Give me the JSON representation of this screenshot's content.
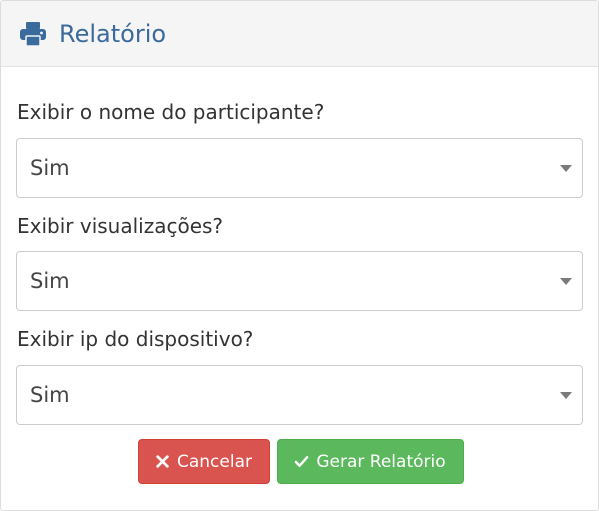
{
  "panel": {
    "title": "Relatório",
    "icon": "printer-icon"
  },
  "fields": [
    {
      "label": "Exibir o nome do participante?",
      "value": "Sim"
    },
    {
      "label": "Exibir visualizações?",
      "value": "Sim"
    },
    {
      "label": "Exibir ip do dispositivo?",
      "value": "Sim"
    }
  ],
  "buttons": {
    "cancel_label": "Cancelar",
    "cancel_icon": "times-icon",
    "generate_label": "Gerar Relatório",
    "generate_icon": "check-icon"
  },
  "colors": {
    "title": "#3b6a9c",
    "cancel": "#d9534f",
    "generate": "#5cb85c"
  }
}
